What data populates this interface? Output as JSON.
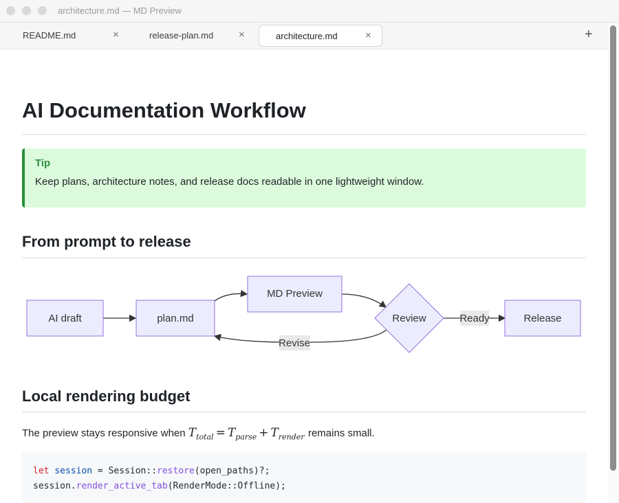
{
  "window": {
    "title": "architecture.md — MD Preview"
  },
  "tabs": [
    {
      "label": "README.md",
      "active": false
    },
    {
      "label": "release-plan.md",
      "active": false
    },
    {
      "label": "architecture.md",
      "active": true
    }
  ],
  "icons": {
    "close": "×",
    "new_tab": "+"
  },
  "document": {
    "title": "AI Documentation Workflow",
    "tip": {
      "title": "Tip",
      "text": "Keep plans, architecture notes, and release docs readable in one lightweight window."
    },
    "section1": {
      "heading": "From prompt to release"
    },
    "diagram": {
      "nodes": {
        "ai_draft": "AI draft",
        "plan": "plan.md",
        "preview": "MD Preview",
        "review": "Review",
        "release": "Release"
      },
      "edges": {
        "ready": "Ready",
        "revise": "Revise"
      }
    },
    "section2": {
      "heading": "Local rendering budget",
      "para_before": "The preview stays responsive when",
      "para_after": "remains small.",
      "formula": {
        "lhs": "T",
        "lhs_sub": "total",
        "eq": "=",
        "t1": "T",
        "t1_sub": "parse",
        "plus": "+",
        "t2": "T",
        "t2_sub": "render"
      }
    },
    "code": {
      "line1": {
        "kw": "let",
        "var": "session",
        "mid": " = Session::",
        "fn": "restore",
        "rest": "(open_paths)?;"
      },
      "line2": {
        "obj": "session.",
        "fn": "render_active_tab",
        "rest": "(RenderMode::Offline);"
      }
    }
  },
  "colors": {
    "tip_bg": "#dcfbdc",
    "tip_accent": "#2c8f3e",
    "node_fill": "#ececff",
    "node_stroke": "#9370db",
    "edge_label_bg": "#e8e8e8"
  }
}
